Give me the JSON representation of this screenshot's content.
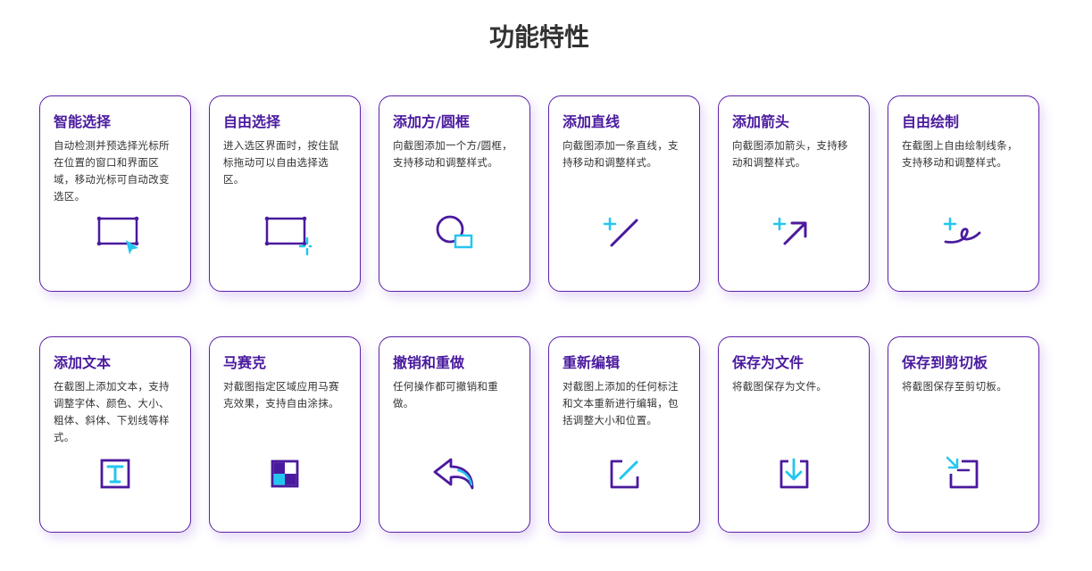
{
  "page": {
    "title": "功能特性"
  },
  "colors": {
    "primary": "#4a1a9e",
    "accent": "#22c7ee",
    "border": "#5b22a6"
  },
  "features": [
    {
      "title": "智能选择",
      "desc": "自动检测并预选择光标所在位置的窗口和界面区域，移动光标可自动改变选区。",
      "icon": "smart-select-icon"
    },
    {
      "title": "自由选择",
      "desc": "进入选区界面时，按住鼠标拖动可以自由选择选区。",
      "icon": "free-select-icon"
    },
    {
      "title": "添加方/圆框",
      "desc": "向截图添加一个方/圆框，支持移动和调整样式。",
      "icon": "shape-icon"
    },
    {
      "title": "添加直线",
      "desc": "向截图添加一条直线，支持移动和调整样式。",
      "icon": "line-icon"
    },
    {
      "title": "添加箭头",
      "desc": "向截图添加箭头，支持移动和调整样式。",
      "icon": "arrow-icon"
    },
    {
      "title": "自由绘制",
      "desc": "在截图上自由绘制线条，支持移动和调整样式。",
      "icon": "freehand-icon"
    },
    {
      "title": "添加文本",
      "desc": "在截图上添加文本，支持调整字体、颜色、大小、粗体、斜体、下划线等样式。",
      "icon": "text-icon"
    },
    {
      "title": "马赛克",
      "desc": "对截图指定区域应用马赛克效果，支持自由涂抹。",
      "icon": "mosaic-icon"
    },
    {
      "title": "撤销和重做",
      "desc": "任何操作都可撤销和重做。",
      "icon": "undo-icon"
    },
    {
      "title": "重新编辑",
      "desc": "对截图上添加的任何标注和文本重新进行编辑，包括调整大小和位置。",
      "icon": "edit-icon"
    },
    {
      "title": "保存为文件",
      "desc": "将截图保存为文件。",
      "icon": "save-file-icon"
    },
    {
      "title": "保存到剪切板",
      "desc": "将截图保存至剪切板。",
      "icon": "clipboard-icon"
    }
  ]
}
